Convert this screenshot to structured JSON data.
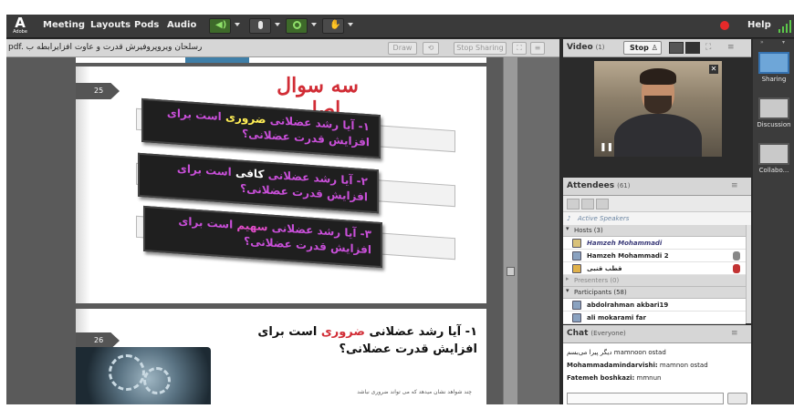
{
  "topbar": {
    "logo_text": "Adobe",
    "menu": [
      "Meeting",
      "Layouts",
      "Pods",
      "Audio"
    ],
    "help": "Help"
  },
  "share_pod": {
    "title": "pdf. رسلحان ویروپروفیرش قدرت و عاوت افزایرابطه ب",
    "buttons": {
      "draw": "Draw",
      "stop_sharing": "Stop Sharing"
    },
    "slide1": {
      "number": "25",
      "heading": "سه سوال اصلی",
      "questions": [
        {
          "prefix": "۱- آیا رشد عضلانی ",
          "emphasis": "ضروری",
          "suffix": " است برای افزایش قدرت عضلانی؟"
        },
        {
          "prefix": "۲- آیا رشد عضلانی ",
          "emphasis": "کافی",
          "suffix": " است برای افزایش قدرت عضلانی؟"
        },
        {
          "prefix": "۳- آیا رشد عضلانی ",
          "emphasis": "سهیم",
          "suffix": " است برای افزایش قدرت عضلانی؟"
        }
      ]
    },
    "slide2": {
      "number": "26",
      "title_prefix": "۱- آیا رشد عضلانی ",
      "title_emphasis": "ضروری",
      "title_suffix": " است برای افزایش قدرت عضلانی؟",
      "subtitle": "چند شواهد نشان میدهد که می تواند ضروری نباشد"
    }
  },
  "video_pod": {
    "title": "Video",
    "count": "(1)",
    "stop_label": "Stop"
  },
  "attendees_pod": {
    "title": "Attendees",
    "count": "(61)",
    "active_speakers": "Active Speakers",
    "hosts_label": "Hosts (3)",
    "hosts": [
      {
        "name": "Hamzeh Mohammadi",
        "italic": true
      },
      {
        "name": "Hamzeh Mohammadi 2",
        "italic": false
      },
      {
        "name": "قطب قنبی",
        "italic": false
      }
    ],
    "presenters_label": "Presenters (0)",
    "participants_label": "Participants (58)",
    "participants": [
      "abdolrahman akbari19",
      "ali mokarami far"
    ]
  },
  "chat_pod": {
    "title": "Chat",
    "scope": "(Everyone)",
    "messages": [
      {
        "sender": "",
        "text": "دیگر پیرا می‌بسم mamnoon ostad"
      },
      {
        "sender": "Mohammadamindarvishi:",
        "text": " mamnon ostad"
      },
      {
        "sender": "Fatemeh boshkazi:",
        "text": " mmnun"
      }
    ]
  },
  "sidebar": {
    "items": [
      "Sharing",
      "Discussion",
      "Collabo..."
    ]
  },
  "colors": {
    "accent_red": "#d12d36",
    "highlight_purple": "#c84fd8",
    "highlight_yellow": "#ffee55",
    "status_green": "#5cc84a"
  }
}
